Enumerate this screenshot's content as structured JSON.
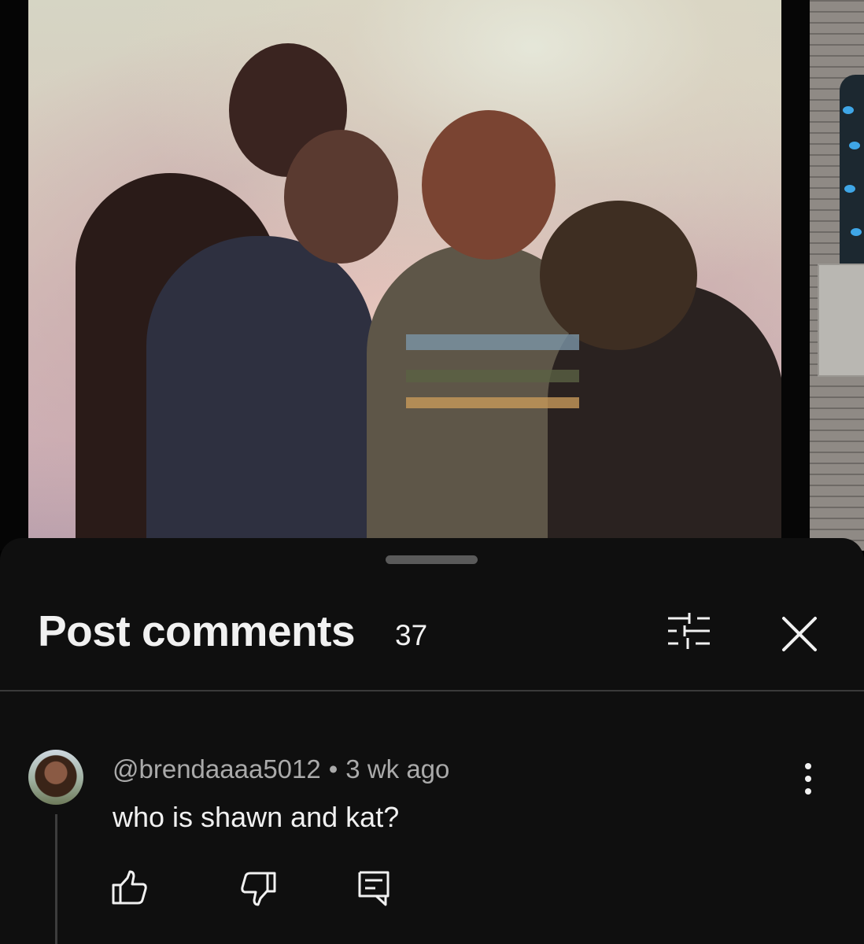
{
  "sheet": {
    "title": "Post comments",
    "count": "37"
  },
  "comments": [
    {
      "author": "@brendaaaa5012",
      "separator": "•",
      "time": "3 wk ago",
      "text": "who is shawn and kat?"
    }
  ],
  "icons": {
    "filter": "sliders-icon",
    "close": "close-icon",
    "more": "more-vert-icon",
    "like": "thumb-up-icon",
    "dislike": "thumb-down-icon",
    "reply": "reply-comment-icon"
  },
  "colors": {
    "sheet_background": "#0f0f0f",
    "primary_text": "#f1f1f1",
    "secondary_text": "#aaaaaa",
    "divider": "#3a3a3a"
  }
}
